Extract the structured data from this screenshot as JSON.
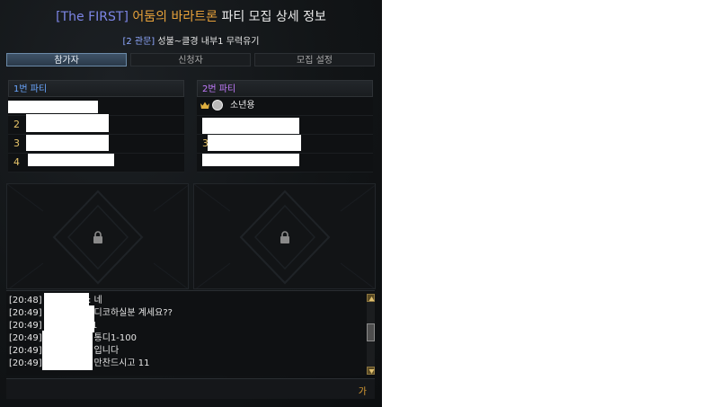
{
  "window": {
    "title_prefix": "[The FIRST]",
    "title_raid": "어둠의 바라트론",
    "title_suffix": "파티 모집 상세 정보",
    "subtitle_bracket": "[2 관문]",
    "subtitle_text": "성불~클경 내부1 무력유기"
  },
  "tabs": [
    {
      "label": "참가자",
      "active": true
    },
    {
      "label": "신청자",
      "active": false
    },
    {
      "label": "모집 설정",
      "active": false
    }
  ],
  "parties": [
    {
      "header": "1번 파티",
      "slots": [
        {
          "number": ""
        },
        {
          "number": "2"
        },
        {
          "number": "3"
        },
        {
          "number": "4"
        }
      ]
    },
    {
      "header": "2번 파티",
      "leader_name": "소년용",
      "slots": [
        {
          "number": ""
        },
        {
          "number": ""
        },
        {
          "number": "3"
        },
        {
          "number": ""
        }
      ]
    }
  ],
  "chat": {
    "lines": [
      {
        "time": "[20:48]",
        "message": ": 네"
      },
      {
        "time": "[20:49]",
        "message": ": 디코하실분 계세요??"
      },
      {
        "time": "[20:49]",
        "message": "1"
      },
      {
        "time": "[20:49]",
        "message": ": 통디1-100"
      },
      {
        "time": "[20:49]",
        "message": ": 입니다"
      },
      {
        "time": "[20:49]",
        "message": ": 만찬드시고 11"
      }
    ],
    "send_label": "가"
  },
  "icons": {
    "lock": "lock-icon",
    "crown": "crown-icon",
    "scroll_up": "scroll-up-icon",
    "scroll_down": "scroll-down-icon"
  },
  "colors": {
    "title_prefix": "#7d86e6",
    "title_raid": "#e8a23a",
    "party1_header": "#6aa6ff",
    "party2_header": "#c47cff",
    "slot_number": "#e8c56a",
    "active_tab": "#3f5368"
  }
}
